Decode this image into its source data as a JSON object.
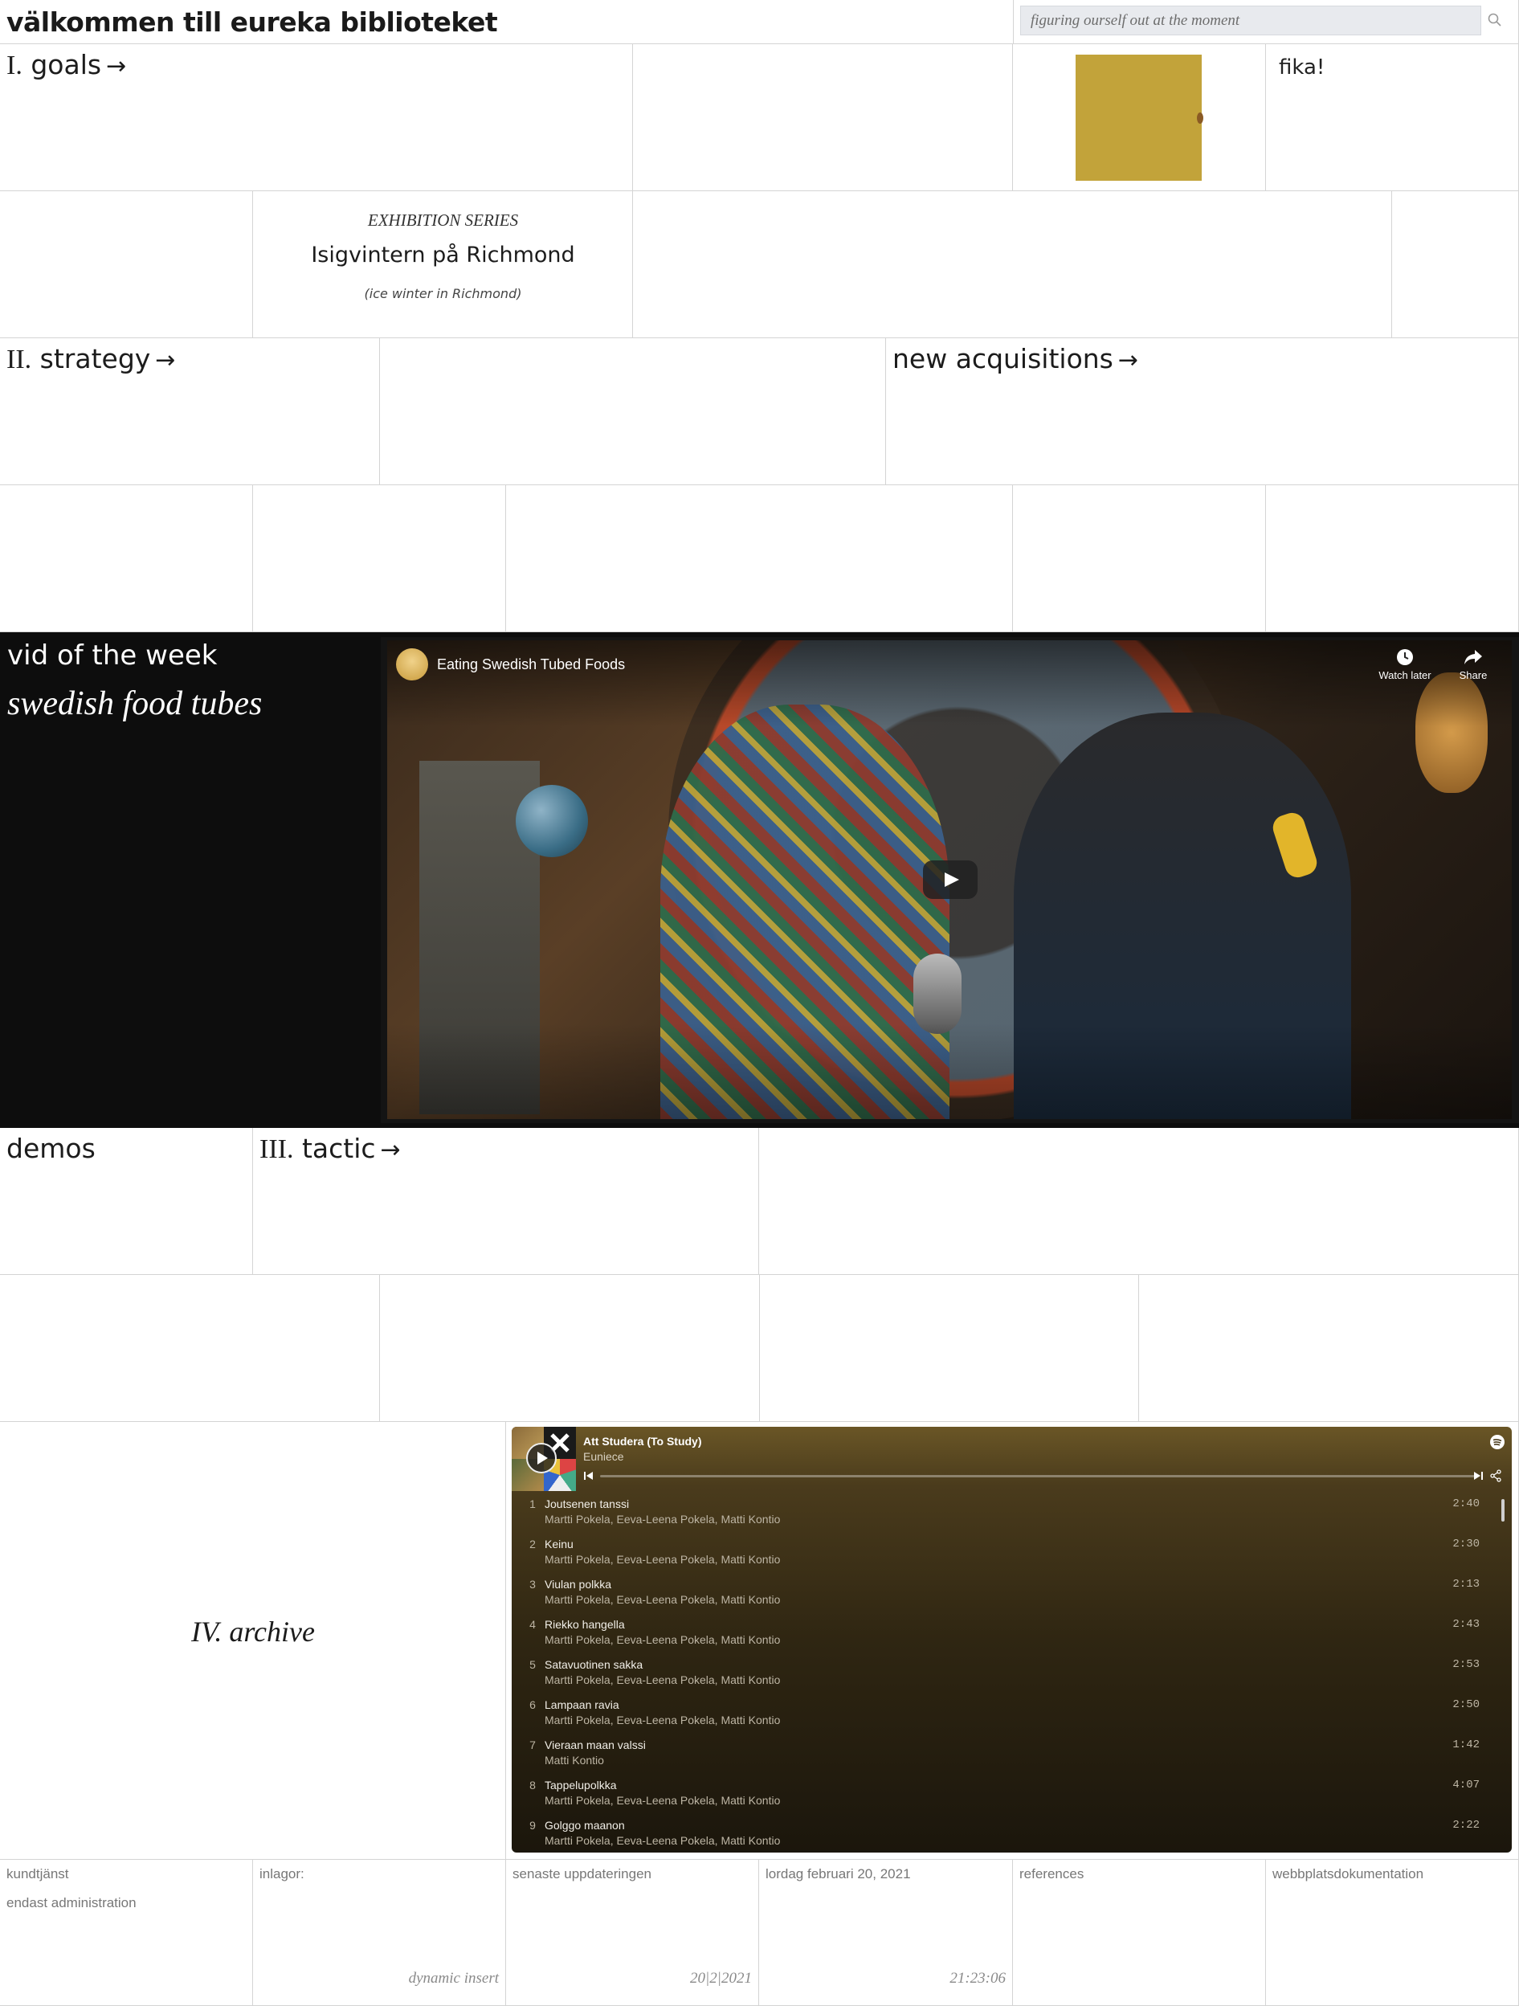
{
  "header": {
    "title": "välkommen till eureka biblioteket",
    "search_placeholder": "figuring ourself out at the moment"
  },
  "sections": {
    "goals": {
      "numeral": "I.",
      "label": "goals"
    },
    "fika": "fika!",
    "exhibition": {
      "kicker": "EXHIBITION SERIES",
      "title": "Isigvintern på Richmond",
      "subtitle": "(ice winter in Richmond)"
    },
    "strategy": {
      "numeral": "II.",
      "label": "strategy"
    },
    "new_acquisitions": "new acquisitions",
    "vid_of_week": {
      "heading": "vid of the week",
      "subheading": "swedish food tubes"
    },
    "demos": "demos",
    "tactic": {
      "numeral": "III.",
      "label": "tactic"
    },
    "archive": "IV. archive"
  },
  "arrow_glyph": "→",
  "video": {
    "title": "Eating Swedish Tubed Foods",
    "watch_later": "Watch later",
    "share": "Share"
  },
  "spotify": {
    "playlist": "Att Studera (To Study)",
    "owner": "Euniece",
    "tracks": [
      {
        "n": "1",
        "title": "Joutsenen tanssi",
        "artists": "Martti Pokela, Eeva-Leena Pokela, Matti Kontio",
        "dur": "2:40"
      },
      {
        "n": "2",
        "title": "Keinu",
        "artists": "Martti Pokela, Eeva-Leena Pokela, Matti Kontio",
        "dur": "2:30"
      },
      {
        "n": "3",
        "title": "Viulan polkka",
        "artists": "Martti Pokela, Eeva-Leena Pokela, Matti Kontio",
        "dur": "2:13"
      },
      {
        "n": "4",
        "title": "Riekko hangella",
        "artists": "Martti Pokela, Eeva-Leena Pokela, Matti Kontio",
        "dur": "2:43"
      },
      {
        "n": "5",
        "title": "Satavuotinen sakka",
        "artists": "Martti Pokela, Eeva-Leena Pokela, Matti Kontio",
        "dur": "2:53"
      },
      {
        "n": "6",
        "title": "Lampaan ravia",
        "artists": "Martti Pokela, Eeva-Leena Pokela, Matti Kontio",
        "dur": "2:50"
      },
      {
        "n": "7",
        "title": "Vieraan maan valssi",
        "artists": "Matti Kontio",
        "dur": "1:42"
      },
      {
        "n": "8",
        "title": "Tappelupolkka",
        "artists": "Martti Pokela, Eeva-Leena Pokela, Matti Kontio",
        "dur": "4:07"
      },
      {
        "n": "9",
        "title": "Golggo maanon",
        "artists": "Martti Pokela, Eeva-Leena Pokela, Matti Kontio",
        "dur": "2:22"
      }
    ]
  },
  "footer": {
    "kundtjanst": "kundtjänst",
    "admin_link": "endast administration",
    "inlagor": "inlagor:",
    "dynamic_insert": "dynamic insert",
    "senaste": "senaste uppdateringen",
    "update_date": "20|2|2021",
    "long_date": "lordag februari 20, 2021",
    "time": "21:23:06",
    "references": "references",
    "docs": "webbplatsdokumentation"
  },
  "colors": {
    "fika_square": "#c2a33a",
    "dark_panel": "#0d0d0d",
    "grid_line": "#d4d4d4"
  }
}
